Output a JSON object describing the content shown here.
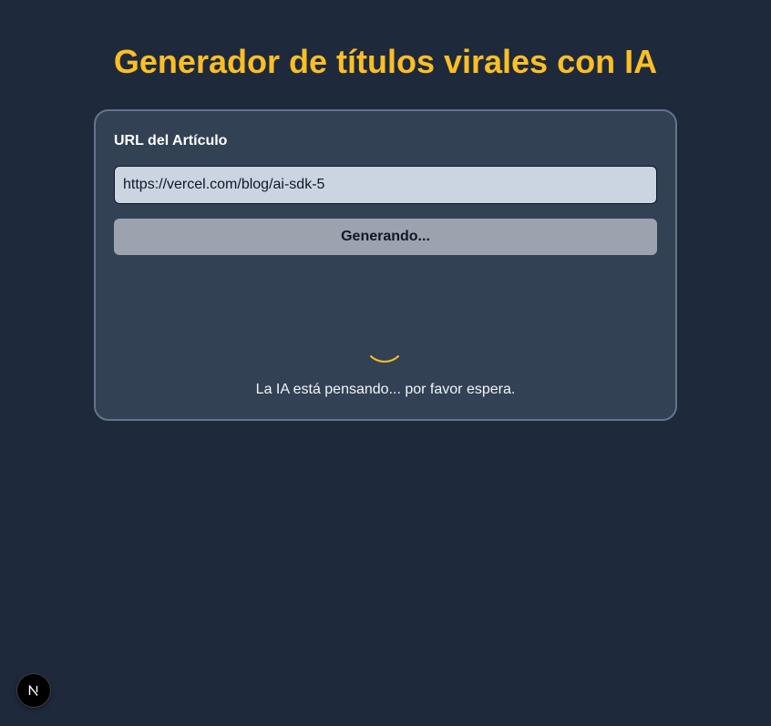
{
  "header": {
    "title": "Generador de títulos virales con IA"
  },
  "form": {
    "url_label": "URL del Artículo",
    "url_value": "https://vercel.com/blog/ai-sdk-5",
    "submit_label": "Generando..."
  },
  "status": {
    "message": "La IA está pensando... por favor espera."
  },
  "colors": {
    "background": "#1e293b",
    "card": "#334155",
    "accent": "#fbbf24",
    "button_disabled": "#9ca3af"
  },
  "icons": {
    "spinner": "loading-spinner-icon",
    "devtools": "nextjs-logo-icon"
  }
}
